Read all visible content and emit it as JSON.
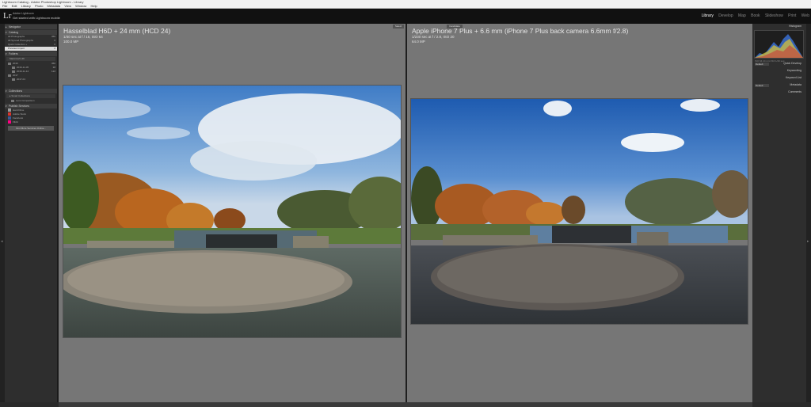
{
  "window": {
    "title": "Lightroom Catalog - Adobe Photoshop Lightroom - Library",
    "menu": [
      "File",
      "Edit",
      "Library",
      "Photo",
      "Metadata",
      "View",
      "Window",
      "Help"
    ]
  },
  "identity": {
    "logo": "Lr",
    "user": "Adobe Lightroom",
    "subtitle": "Get started with Lightroom mobile"
  },
  "modules": [
    {
      "label": "Library",
      "active": true
    },
    {
      "label": "Develop",
      "active": false
    },
    {
      "label": "Map",
      "active": false
    },
    {
      "label": "Book",
      "active": false
    },
    {
      "label": "Slideshow",
      "active": false
    },
    {
      "label": "Print",
      "active": false
    },
    {
      "label": "Web",
      "active": false
    }
  ],
  "left_panel": {
    "navigator_label": "Navigator",
    "catalog_label": "Catalog",
    "catalog_items": [
      {
        "label": "All Photographs",
        "count": "360"
      },
      {
        "label": "All Synced Photographs",
        "count": "0"
      },
      {
        "label": "Quick Collection +",
        "count": "0"
      },
      {
        "label": "Previous Import",
        "count": "2",
        "selected": true
      }
    ],
    "folders_label": "Folders",
    "folders_volume": "Macintosh HD",
    "folders": [
      {
        "label": "2016",
        "count": "360"
      },
      {
        "label": "2016-11-05",
        "count": "38"
      },
      {
        "label": "2016-11-12",
        "count": "122"
      },
      {
        "label": "2017",
        "count": ""
      },
      {
        "label": "2017-01",
        "count": ""
      }
    ],
    "collections_label": "Collections",
    "collections": [
      {
        "label": "Smart Collections"
      },
      {
        "label": "Lens Comparison"
      }
    ],
    "publish_label": "Publish Services",
    "publish": [
      {
        "label": "Hard Drive",
        "color": "#9a9a9a"
      },
      {
        "label": "Adobe Stock",
        "color": "#d9342b"
      },
      {
        "label": "Facebook",
        "color": "#3b5998"
      },
      {
        "label": "Flickr",
        "color": "#ff0084"
      }
    ],
    "find_more": "Find More Services Online..."
  },
  "panes": {
    "left": {
      "title": "Hasselblad H6D + 24 mm (HCD 24)",
      "exposure": "1/40 sec at f / 16, ISO 64",
      "megapixels": "100.0 MP",
      "tag": "Select"
    },
    "right": {
      "title": "Apple iPhone 7 Plus + 6.6 mm (iPhone 7 Plus back camera 6.6mm f/2.8)",
      "exposure": "1/230 sec at f / 2.8, ISO 20",
      "megapixels": "64.0 MP",
      "tag": "Candidate"
    }
  },
  "right_panel": {
    "histogram_label": "Histogram",
    "histogram_meta": "ISO 64   24 mm   f/16   1/40 sec",
    "quick_develop_preset": "Default",
    "quick_develop_label": "Quick Develop",
    "keywording_label": "Keywording",
    "keyword_list_label": "Keyword List",
    "metadata_preset": "Default",
    "metadata_label": "Metadata",
    "comments_label": "Comments"
  },
  "colors": {
    "active_module": "#ffffff",
    "inactive_module": "#888888",
    "pane_background": "#767676",
    "panel_background": "#2e2e2e"
  }
}
